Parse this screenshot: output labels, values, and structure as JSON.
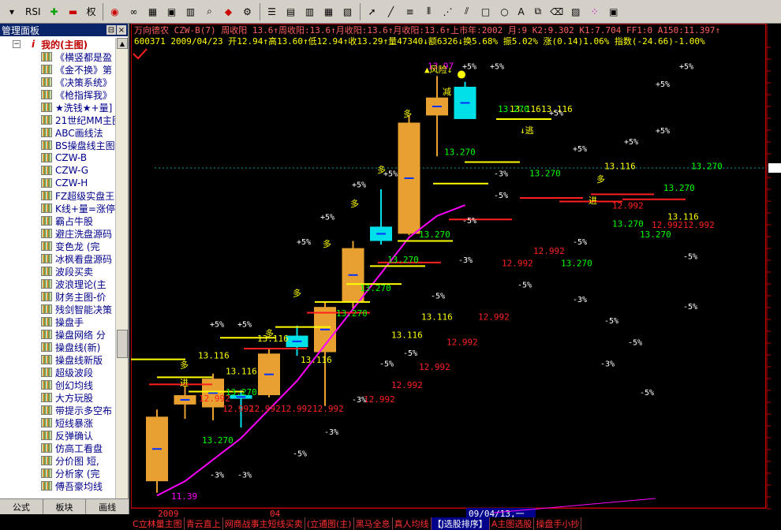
{
  "toolbar": {
    "items": [
      "rsi-button",
      "move-button",
      "minus-button",
      "quan",
      "circles-button",
      "glasses-button",
      "grid-button",
      "camera-button",
      "book-button",
      "zoom-button",
      "alarm-button",
      "settings-button",
      "layout1",
      "layout2",
      "layout3",
      "layout4",
      "layout5",
      "cursor",
      "draw-line",
      "draw-channel",
      "draw-vlines",
      "draw-fan",
      "draw-parallel",
      "draw-rect",
      "draw-circle",
      "draw-text",
      "copy",
      "eraser",
      "color-button",
      "palette-button",
      "save-button"
    ],
    "quan_label": "权",
    "rsi_label": "RSI",
    "text_tool": "A"
  },
  "panel": {
    "title": "管理面板",
    "root_label": "我的(主图)",
    "items": [
      {
        "label": "《横竖都是盈",
        "selected": false
      },
      {
        "label": "《金不换》第",
        "selected": false
      },
      {
        "label": "《决策系统》",
        "selected": false
      },
      {
        "label": "《枪指挥我》",
        "selected": false
      },
      {
        "label": "★洗钱★+量]",
        "selected": false
      },
      {
        "label": "21世纪MM主图",
        "selected": false
      },
      {
        "label": "ABC画线法",
        "selected": false
      },
      {
        "label": "BS操盘线主图",
        "selected": false
      },
      {
        "label": "CZW-B",
        "selected": true
      },
      {
        "label": "CZW-G",
        "selected": false
      },
      {
        "label": "CZW-H",
        "selected": false
      },
      {
        "label": "FZ超级实盘王",
        "selected": false
      },
      {
        "label": "K线+量=涨停",
        "selected": false
      },
      {
        "label": "霸占牛股",
        "selected": false
      },
      {
        "label": "避庄洗盘源码",
        "selected": false
      },
      {
        "label": "变色龙 (完",
        "selected": false
      },
      {
        "label": "冰枫看盘源码",
        "selected": false
      },
      {
        "label": "波段买卖",
        "selected": false
      },
      {
        "label": "波浪理论(主",
        "selected": false
      },
      {
        "label": "财务主图-价",
        "selected": false
      },
      {
        "label": "残剑智能决策",
        "selected": false
      },
      {
        "label": "操盘手",
        "selected": false
      },
      {
        "label": "操盘网络 分",
        "selected": false
      },
      {
        "label": "操盘线(新)",
        "selected": false
      },
      {
        "label": "操盘线新版",
        "selected": false
      },
      {
        "label": "超级波段",
        "selected": false
      },
      {
        "label": "创幻均线",
        "selected": false
      },
      {
        "label": "大方玩股",
        "selected": false
      },
      {
        "label": "带提示多空布",
        "selected": false
      },
      {
        "label": "短线暴涨",
        "selected": false
      },
      {
        "label": "反弹确认",
        "selected": false
      },
      {
        "label": "仿高工看盘",
        "selected": false
      },
      {
        "label": "分价图 短,",
        "selected": false
      },
      {
        "label": "分析家 (完",
        "selected": false
      },
      {
        "label": "傅吾豪均线",
        "selected": false
      }
    ],
    "tabs": [
      "公式",
      "板块",
      "画线"
    ]
  },
  "info": {
    "line1": "万向德农 CZW-B(7) 周收阳 13.6↑周收阳:13.6↑月收阳:13.6↑月收阳:13.6↑上市年:2002 月:9 K2:9.302 K1:7.704 FF1:0 A150:11.397↑",
    "line2": "600371 2009/04/23 开12.94↑高13.60↑低12.94↑收13.29↑量47340↓额6326↓换5.68% 振5.02% 涨(0.14)1.06% 指数(-24.66)-1.00%"
  },
  "colors": {
    "up": "#e8a030",
    "down": "#00e0e8",
    "ma": "#ff00ff",
    "yellow": "#ffff00",
    "red": "#ff2020",
    "green": "#00ff00",
    "white": "#ffffff"
  },
  "axis": {
    "year": "2009",
    "month": "04",
    "date_label": "09/04/13,一"
  },
  "chart_data": {
    "type": "candlestick",
    "candles": [
      {
        "o": 11.55,
        "h": 12.55,
        "l": 11.39,
        "c": 12.45
      },
      {
        "o": 12.62,
        "h": 12.88,
        "l": 12.42,
        "c": 12.75
      },
      {
        "o": 12.58,
        "h": 13.05,
        "l": 12.4,
        "c": 12.98
      },
      {
        "o": 12.75,
        "h": 12.82,
        "l": 12.3,
        "c": 12.7
      },
      {
        "o": 12.75,
        "h": 13.4,
        "l": 12.72,
        "c": 13.33
      },
      {
        "o": 13.58,
        "h": 13.72,
        "l": 13.3,
        "c": 13.42
      },
      {
        "o": 13.35,
        "h": 14.05,
        "l": 12.6,
        "c": 13.98
      },
      {
        "o": 14.05,
        "h": 14.9,
        "l": 13.95,
        "c": 14.8
      },
      {
        "o": 15.1,
        "h": 15.62,
        "l": 14.85,
        "c": 14.9
      },
      {
        "o": 15.0,
        "h": 16.65,
        "l": 14.98,
        "c": 16.55
      },
      {
        "o": 16.65,
        "h": 17.2,
        "l": 16.08,
        "c": 16.9
      },
      {
        "o": 17.05,
        "h": 17.12,
        "l": 16.65,
        "c": 16.6
      }
    ],
    "ma_label": "11.39",
    "high_label": "13.97",
    "labels_yellow": [
      "13.116",
      "13.116",
      "13.116",
      "13.116",
      "13.116",
      "13.116",
      "13.116",
      "13.116",
      "13.116"
    ],
    "labels_green": [
      "13.270"
    ],
    "labels_red": [
      "12.992"
    ],
    "pct_labels": [
      "+5%",
      "+3%",
      "-3%",
      "-5%"
    ],
    "signals": {
      "duo": "多",
      "jin": "进",
      "jian": "减",
      "fengxian": "▲风险↓",
      "tao": "↓逃"
    }
  }
}
